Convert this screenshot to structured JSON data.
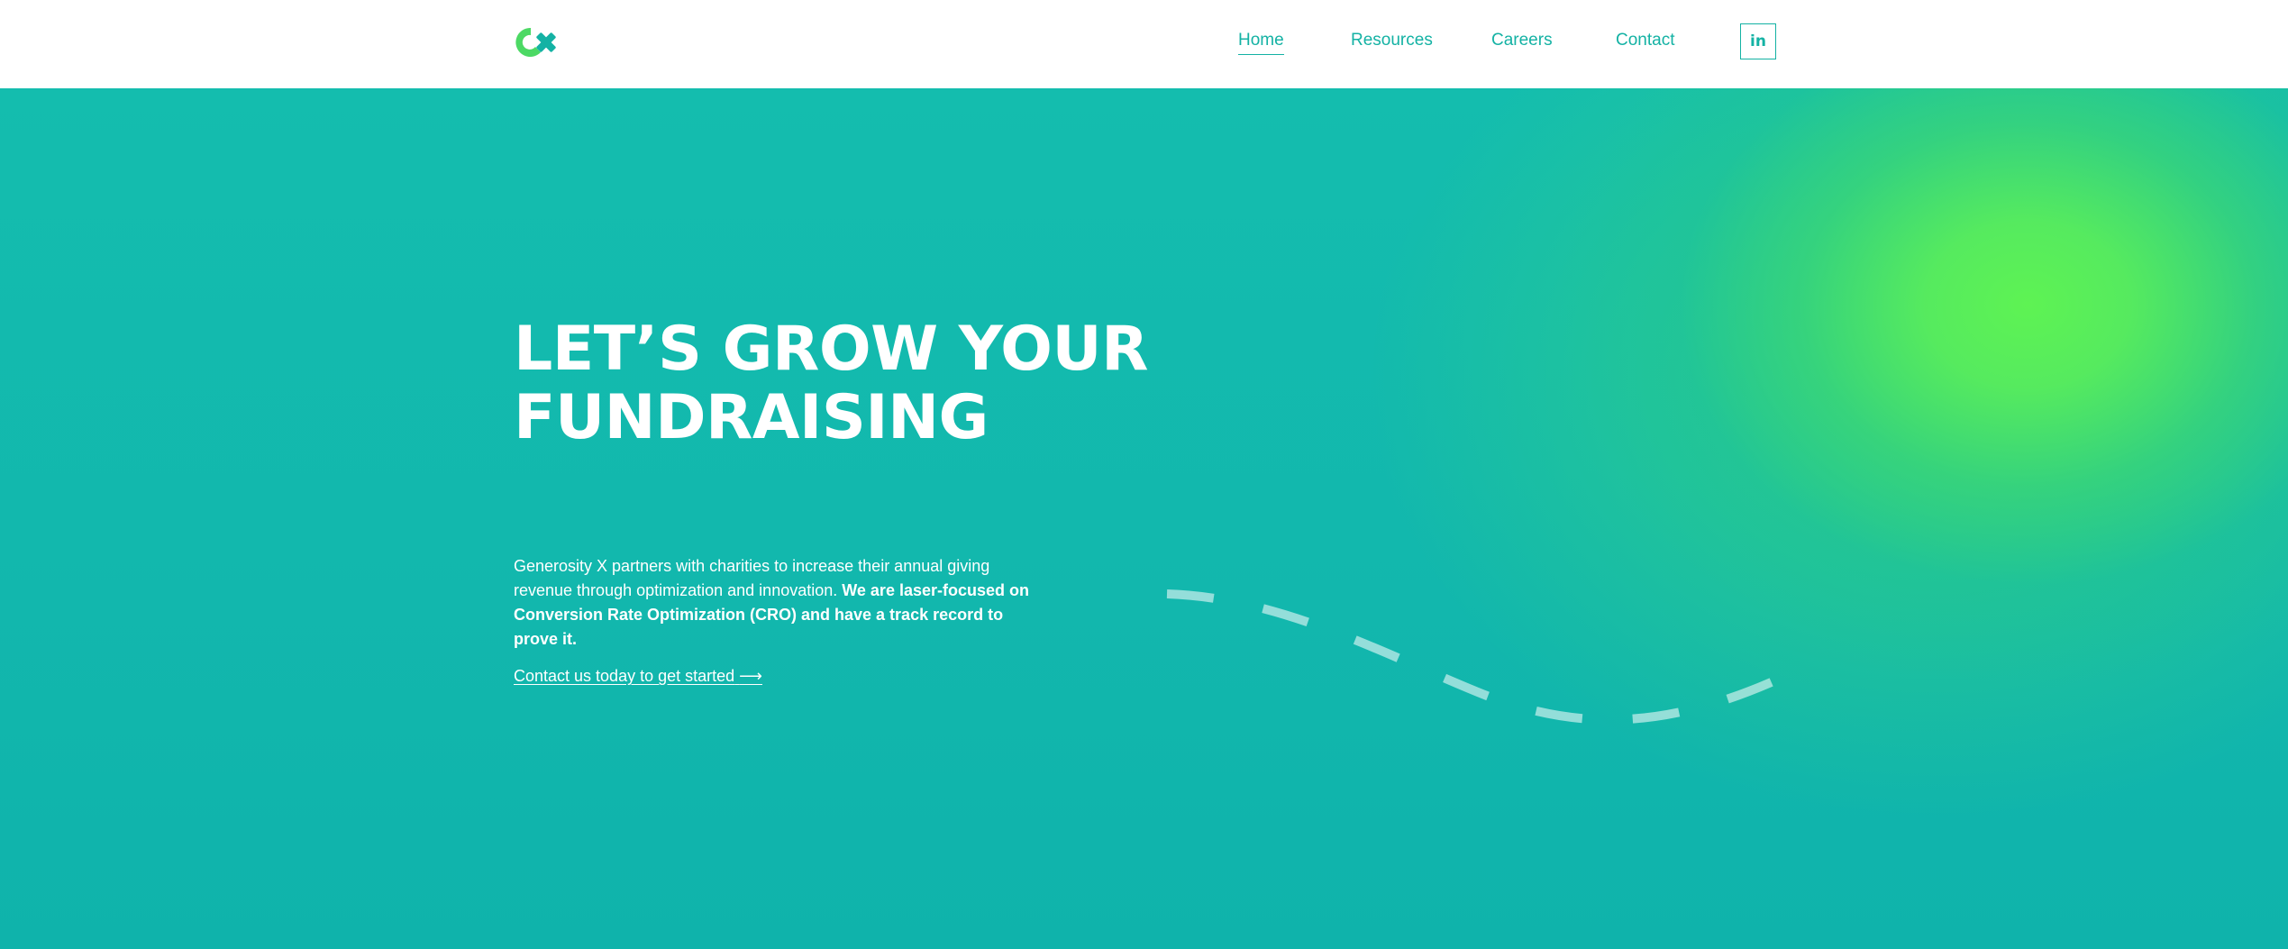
{
  "header": {
    "logo_alt": "Generosity X logo",
    "nav": [
      {
        "label": "Home",
        "active": true
      },
      {
        "label": "Resources",
        "active": false
      },
      {
        "label": "Careers",
        "active": false
      },
      {
        "label": "Contact",
        "active": false
      }
    ],
    "linkedin_label": "in"
  },
  "hero": {
    "title_line1": "LET’S GROW YOUR",
    "title_line2": "FUNDRAISING",
    "description_plain": "Generosity X partners with charities to increase their annual giving revenue through optimization and innovation. ",
    "description_bold": "We are laser-focused on Conversion Rate Optimization (CRO) and have a track record to prove it.",
    "cta_label": "Contact us today to get started",
    "cta_arrow": "⟶"
  },
  "colors": {
    "accent": "#14b2a4",
    "hero_teal": "#12b7ad",
    "hero_green": "#5ef353",
    "logo_green": "#4cd964",
    "logo_teal": "#14b2a4"
  }
}
